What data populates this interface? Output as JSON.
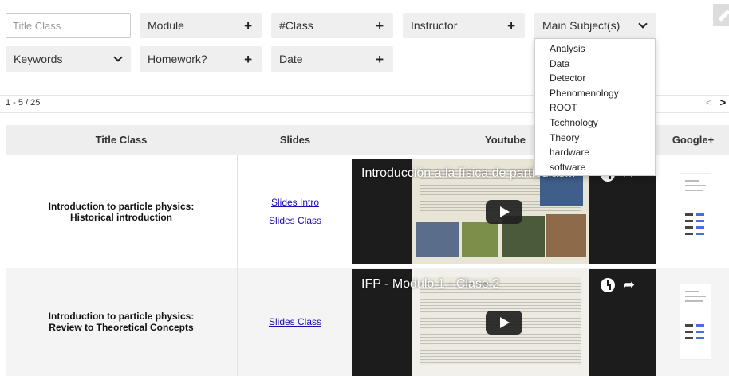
{
  "filters": {
    "title_placeholder": "Title Class",
    "module": "Module",
    "class_num": "#Class",
    "instructor": "Instructor",
    "main_subject": "Main Subject(s)",
    "keywords": "Keywords",
    "homework": "Homework?",
    "date": "Date",
    "plus": "+"
  },
  "subject_options": [
    "Analysis",
    "Data",
    "Detector",
    "Phenomenology",
    "ROOT",
    "Technology",
    "Theory",
    "hardware",
    "software"
  ],
  "pagination": {
    "count": "1 - 5 / 25",
    "prev": "<",
    "next": ">"
  },
  "table": {
    "headers": {
      "title": "Title Class",
      "slides": "Slides",
      "youtube": "Youtube",
      "google": "Google+"
    },
    "rows": [
      {
        "title_line1": "Introduction to particle physics:",
        "title_line2": "Historical introduction",
        "slides": [
          "Slides Intro",
          "Slides Class"
        ],
        "video_title": "Introducción a la física de partículas..."
      },
      {
        "title_line1": "Introduction to particle physics:",
        "title_line2": "Review to Theoretical Concepts",
        "slides": [
          "Slides Class"
        ],
        "video_title": "IFP - Modulo 1 - Clase 2"
      }
    ]
  },
  "colors": {
    "link": "#1a0dab",
    "header_bg": "#eeeeee",
    "filter_bg": "#efefef"
  }
}
